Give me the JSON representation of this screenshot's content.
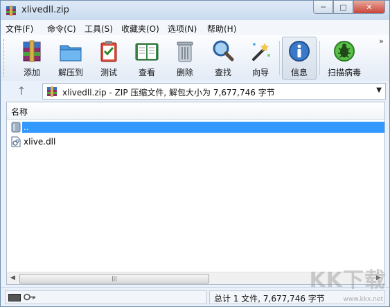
{
  "window": {
    "title": "xlivedll.zip"
  },
  "window_controls": {
    "minimize": "─",
    "maximize": "□",
    "close": "✕"
  },
  "menu": [
    "文件(F)",
    "命令(C)",
    "工具(S)",
    "收藏夹(O)",
    "选项(N)",
    "帮助(H)"
  ],
  "toolbar": {
    "buttons": [
      {
        "label": "添加",
        "icon": "add-archive-icon"
      },
      {
        "label": "解压到",
        "icon": "extract-to-icon"
      },
      {
        "label": "测试",
        "icon": "test-icon"
      },
      {
        "label": "查看",
        "icon": "view-book-icon"
      },
      {
        "label": "删除",
        "icon": "trash-icon"
      },
      {
        "label": "查找",
        "icon": "magnifier-icon"
      },
      {
        "label": "向导",
        "icon": "wizard-wand-icon"
      },
      {
        "label": "信息",
        "icon": "info-icon"
      },
      {
        "label": "扫描病毒",
        "icon": "virus-bug-icon"
      }
    ],
    "more": "»"
  },
  "address": {
    "up": "↑",
    "text": "xlivedll.zip - ZIP 压缩文件, 解包大小为 7,677,746 字节",
    "dropdown": "▼"
  },
  "filelist": {
    "column_name": "名称",
    "rows": [
      {
        "name": "..",
        "selected": true
      },
      {
        "name": "xlive.dll",
        "selected": false
      }
    ]
  },
  "scrollbar": {
    "left": "◀",
    "right": "▶",
    "grip": "|||"
  },
  "status": {
    "summary": "总计 1 文件, 7,677,746 字节"
  },
  "watermark": {
    "mark": "KK下载",
    "url": "www.kkx.net"
  },
  "colors": {
    "selection": "#3399ff",
    "accent": "#3a78c9"
  }
}
